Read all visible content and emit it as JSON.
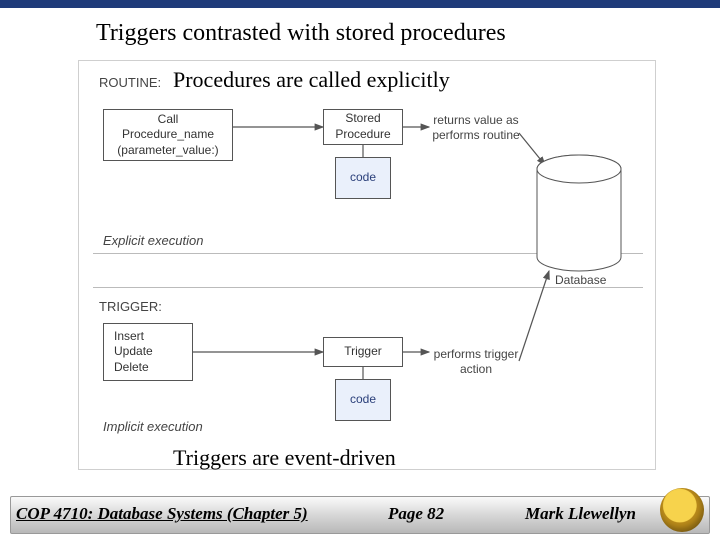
{
  "title": "Triggers contrasted with stored procedures",
  "subtitle_top": "Procedures are called explicitly",
  "subtitle_bottom": "Triggers are event-driven",
  "sections": {
    "routine": "ROUTINE:",
    "trigger": "TRIGGER:",
    "explicit": "Explicit execution",
    "implicit": "Implicit execution"
  },
  "routine": {
    "call_line1": "Call",
    "call_line2": "Procedure_name",
    "call_line3": "(parameter_value:)",
    "stored_proc": "Stored\nProcedure",
    "code": "code",
    "returns": "returns value as performs routine"
  },
  "trigger": {
    "iud1": "Insert",
    "iud2": "Update",
    "iud3": "Delete",
    "trigger_box": "Trigger",
    "code": "code",
    "performs": "performs trigger action"
  },
  "db_label": "Database",
  "footer": {
    "course": "COP 4710: Database Systems  (Chapter 5)",
    "page": "Page 82",
    "author": "Mark Llewellyn"
  }
}
